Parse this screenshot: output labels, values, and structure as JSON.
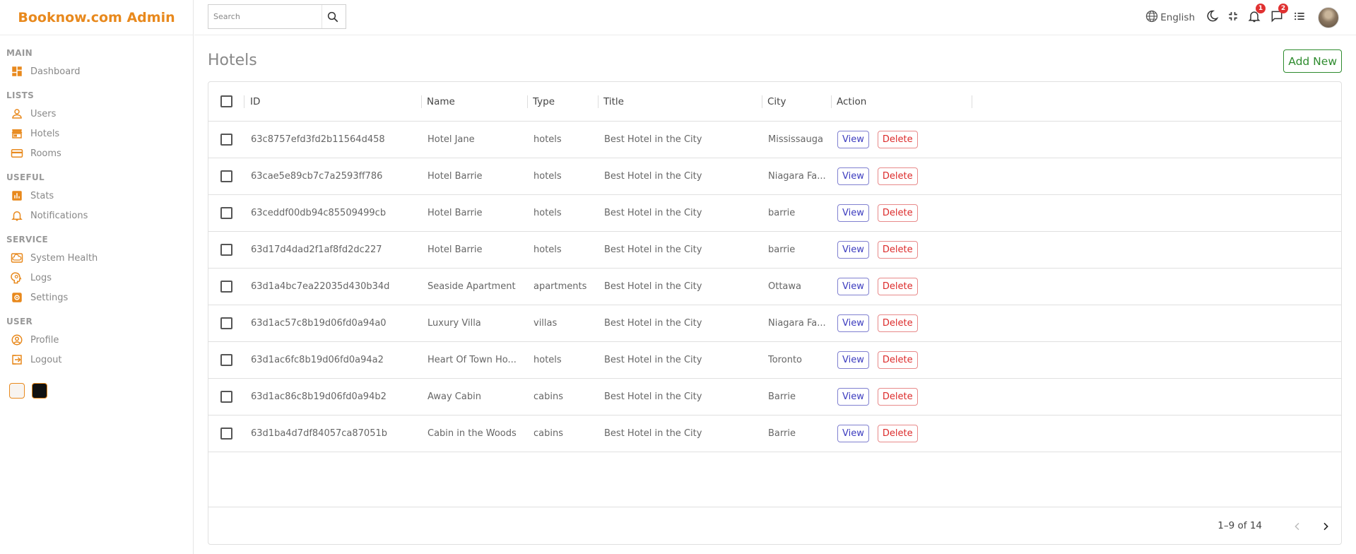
{
  "app": {
    "title": "Booknow.com Admin"
  },
  "colors": {
    "brand": "#e8891d",
    "add_new": "#2e8b2e",
    "view": "#3b3bbf",
    "delete": "#dc2b2b",
    "badge": "#e03131"
  },
  "sidebar": {
    "sections": [
      {
        "title": "MAIN",
        "items": [
          {
            "label": "Dashboard",
            "icon": "dashboard-icon"
          }
        ]
      },
      {
        "title": "LISTS",
        "items": [
          {
            "label": "Users",
            "icon": "person-icon"
          },
          {
            "label": "Hotels",
            "icon": "store-icon"
          },
          {
            "label": "Rooms",
            "icon": "credit-card-icon"
          }
        ]
      },
      {
        "title": "USEFUL",
        "items": [
          {
            "label": "Stats",
            "icon": "bar-chart-icon"
          },
          {
            "label": "Notifications",
            "icon": "bell-icon"
          }
        ]
      },
      {
        "title": "SERVICE",
        "items": [
          {
            "label": "System Health",
            "icon": "cloud-icon"
          },
          {
            "label": "Logs",
            "icon": "psychology-icon"
          },
          {
            "label": "Settings",
            "icon": "settings-icon"
          }
        ]
      },
      {
        "title": "USER",
        "items": [
          {
            "label": "Profile",
            "icon": "account-circle-icon"
          },
          {
            "label": "Logout",
            "icon": "logout-icon"
          }
        ]
      }
    ],
    "theme_swatches": [
      "light",
      "dark"
    ]
  },
  "navbar": {
    "search_placeholder": "Search",
    "language": "English",
    "notifications_count": "1",
    "messages_count": "2"
  },
  "main": {
    "title": "Hotels",
    "add_new_label": "Add New"
  },
  "table": {
    "columns": [
      "ID",
      "Name",
      "Type",
      "Title",
      "City",
      "Action"
    ],
    "view_label": "View",
    "delete_label": "Delete",
    "rows": [
      {
        "id": "63c8757efd3fd2b11564d458",
        "name": "Hotel Jane",
        "type": "hotels",
        "title": "Best Hotel in the City",
        "city": "Mississauga"
      },
      {
        "id": "63cae5e89cb7c7a2593ff786",
        "name": "Hotel Barrie",
        "type": "hotels",
        "title": "Best Hotel in the City",
        "city": "Niagara Fa..."
      },
      {
        "id": "63ceddf00db94c85509499cb",
        "name": "Hotel Barrie",
        "type": "hotels",
        "title": "Best Hotel in the City",
        "city": "barrie"
      },
      {
        "id": "63d17d4dad2f1af8fd2dc227",
        "name": "Hotel Barrie",
        "type": "hotels",
        "title": "Best Hotel in the City",
        "city": "barrie"
      },
      {
        "id": "63d1a4bc7ea22035d430b34d",
        "name": "Seaside Apartment",
        "type": "apartments",
        "title": "Best Hotel in the City",
        "city": "Ottawa"
      },
      {
        "id": "63d1ac57c8b19d06fd0a94a0",
        "name": "Luxury Villa",
        "type": "villas",
        "title": "Best Hotel in the City",
        "city": "Niagara Fa..."
      },
      {
        "id": "63d1ac6fc8b19d06fd0a94a2",
        "name": "Heart Of Town Ho...",
        "type": "hotels",
        "title": "Best Hotel in the City",
        "city": "Toronto"
      },
      {
        "id": "63d1ac86c8b19d06fd0a94b2",
        "name": "Away Cabin",
        "type": "cabins",
        "title": "Best Hotel in the City",
        "city": "Barrie"
      },
      {
        "id": "63d1ba4d7df84057ca87051b",
        "name": "Cabin in the Woods",
        "type": "cabins",
        "title": "Best Hotel in the City",
        "city": "Barrie"
      }
    ],
    "pagination": "1–9 of 14"
  }
}
